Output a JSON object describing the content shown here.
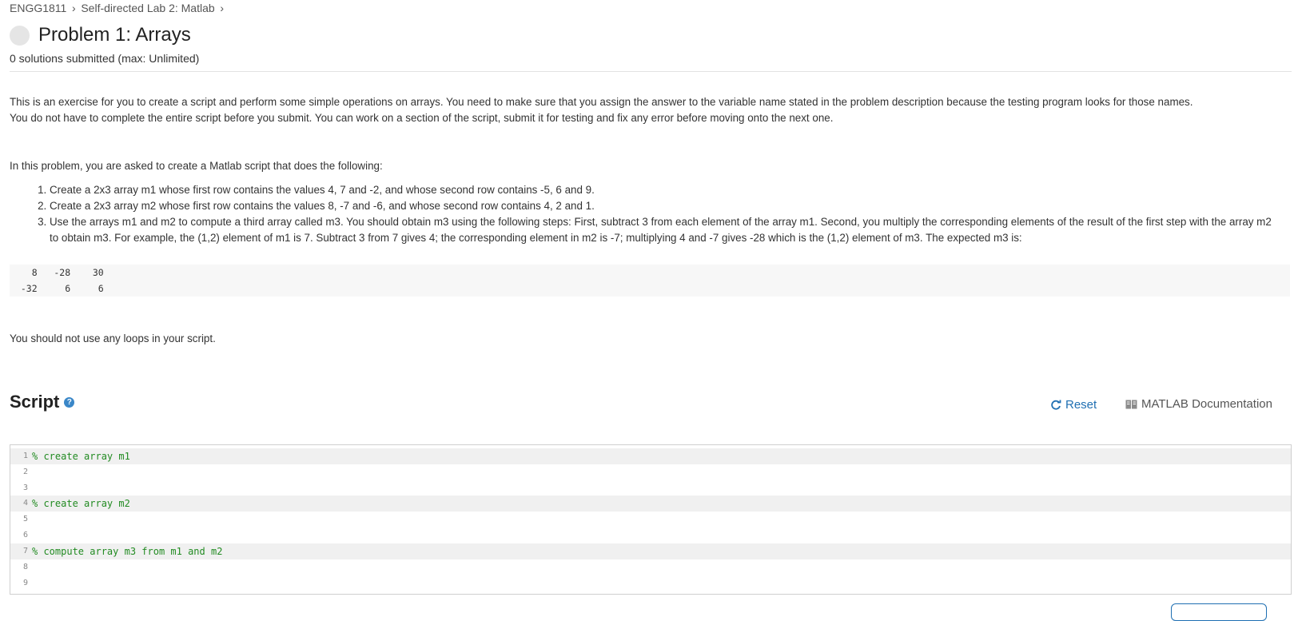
{
  "breadcrumb": {
    "items": [
      "ENGG1811",
      "Self-directed Lab 2: Matlab"
    ],
    "separator": "›"
  },
  "problem": {
    "title": "Problem 1: Arrays",
    "submissions": "0 solutions submitted (max: Unlimited)"
  },
  "description": {
    "intro_line1": "This is an exercise for you to create a script and perform some simple operations on arrays. You need to make sure that you assign the answer to the variable name stated in the problem description because the testing program looks for those names.",
    "intro_line2": "You do not have to complete the entire script before you submit. You can work on a section of the script, submit it for testing and fix any error before moving onto the next one.",
    "task_intro": "In this problem, you are asked to create a Matlab script that does the following:",
    "steps": [
      "Create a 2x3 array m1 whose first row contains the values 4, 7 and -2, and whose second row contains -5, 6 and 9.",
      "Create a 2x3 array m2 whose first row contains the values 8, -7 and -6, and whose second row contains 4, 2 and 1.",
      "Use the arrays m1 and m2 to compute a third array called m3. You should obtain m3 using the following steps: First, subtract 3 from each element of the array m1. Second, you multiply the corresponding elements of the result of the first step with the array m2 to obtain m3. For example, the (1,2) element of m1 is 7. Subtract 3 from 7 gives 4; the corresponding element in m2  is -7; multiplying 4 and -7 gives -28 which is the (1,2) element of m3. The expected m3 is:"
    ],
    "expected_output": [
      "    8   -28    30",
      "  -32     6     6"
    ],
    "no_loops": "You should not use any loops in your script."
  },
  "script": {
    "heading": "Script",
    "help_icon": "question-circle-icon",
    "reset_label": "Reset",
    "docs_label": "MATLAB Documentation",
    "lines": [
      {
        "num": "1",
        "text": "% create array m1"
      },
      {
        "num": "2",
        "text": ""
      },
      {
        "num": "3",
        "text": ""
      },
      {
        "num": "4",
        "text": "% create array m2"
      },
      {
        "num": "5",
        "text": ""
      },
      {
        "num": "6",
        "text": ""
      },
      {
        "num": "7",
        "text": "% compute array m3 from m1 and m2"
      },
      {
        "num": "8",
        "text": ""
      },
      {
        "num": "9",
        "text": ""
      }
    ]
  },
  "colors": {
    "link": "#1f6fb2",
    "comment": "#228b22",
    "status_circle": "#e5e5e5"
  }
}
